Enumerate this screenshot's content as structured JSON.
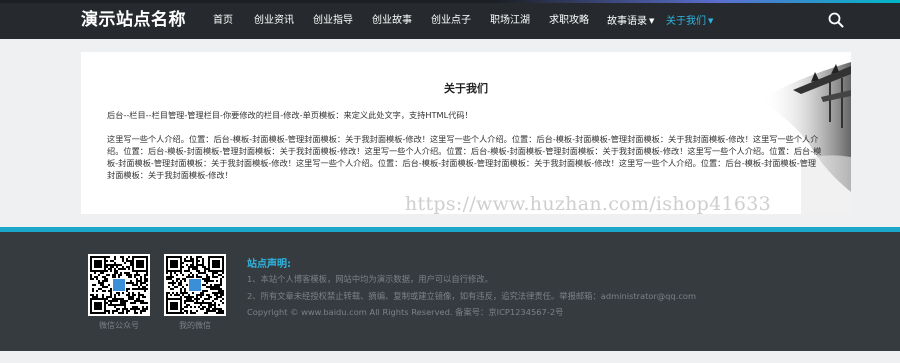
{
  "site": {
    "logo": "演示站点名称"
  },
  "nav": {
    "items": [
      {
        "label": "首页"
      },
      {
        "label": "创业资讯"
      },
      {
        "label": "创业指导"
      },
      {
        "label": "创业故事"
      },
      {
        "label": "创业点子"
      },
      {
        "label": "职场江湖"
      },
      {
        "label": "求职攻略"
      },
      {
        "label": "故事语录"
      },
      {
        "label": "关于我们"
      }
    ],
    "active_label": "关于我们",
    "search_icon": "search-icon"
  },
  "content": {
    "title": "关于我们",
    "paragraphs": [
      "后台--栏目--栏目管理-管理栏目-你要修改的栏目-修改-单页模板：来定义此处文字，支持HTML代码！",
      "这里写一些个人介绍。位置：后台-模板-封面模板-管理封面模板：关于我封面模板-修改！这里写一些个人介绍。位置：后台-模板-封面模板-管理封面模板：关于我封面模板-修改！这里写一些个人介绍。位置：后台-模板-封面模板-管理封面模板：关于我封面模板-修改！这里写一些个人介绍。位置：后台-模板-封面模板-管理封面模板：关于我封面模板-修改！这里写一些个人介绍。位置：后台-模板-封面模板-管理封面模板：关于我封面模板-修改！这里写一些个人介绍。位置：后台-模板-封面模板-管理封面模板：关于我封面模板-修改！这里写一些个人介绍。位置：后台-模板-封面模板-管理封面模板：关于我封面模板-修改！"
    ]
  },
  "watermark": "https://www.huzhan.com/ishop41633",
  "footer": {
    "qr_labels": [
      "微信公众号",
      "我的微信"
    ],
    "declaration_title": "站点声明:",
    "declaration_lines": [
      "1、本站个人博客模板，网站中均为演示数据，用户可以自行修改。",
      "2、所有文章未经授权禁止转载、摘编、复制或建立镜像，如有违反，追究法律责任。举报邮箱：administrator@qq.com",
      "Copyright © www.baidu.com All Rights Reserved. 备案号：京ICP1234567-2号"
    ]
  },
  "colors": {
    "header_bg": "#262a2e",
    "accent": "#2fb5e0",
    "footer_bg": "#363b40",
    "footer_line": "#1ba7c9"
  }
}
